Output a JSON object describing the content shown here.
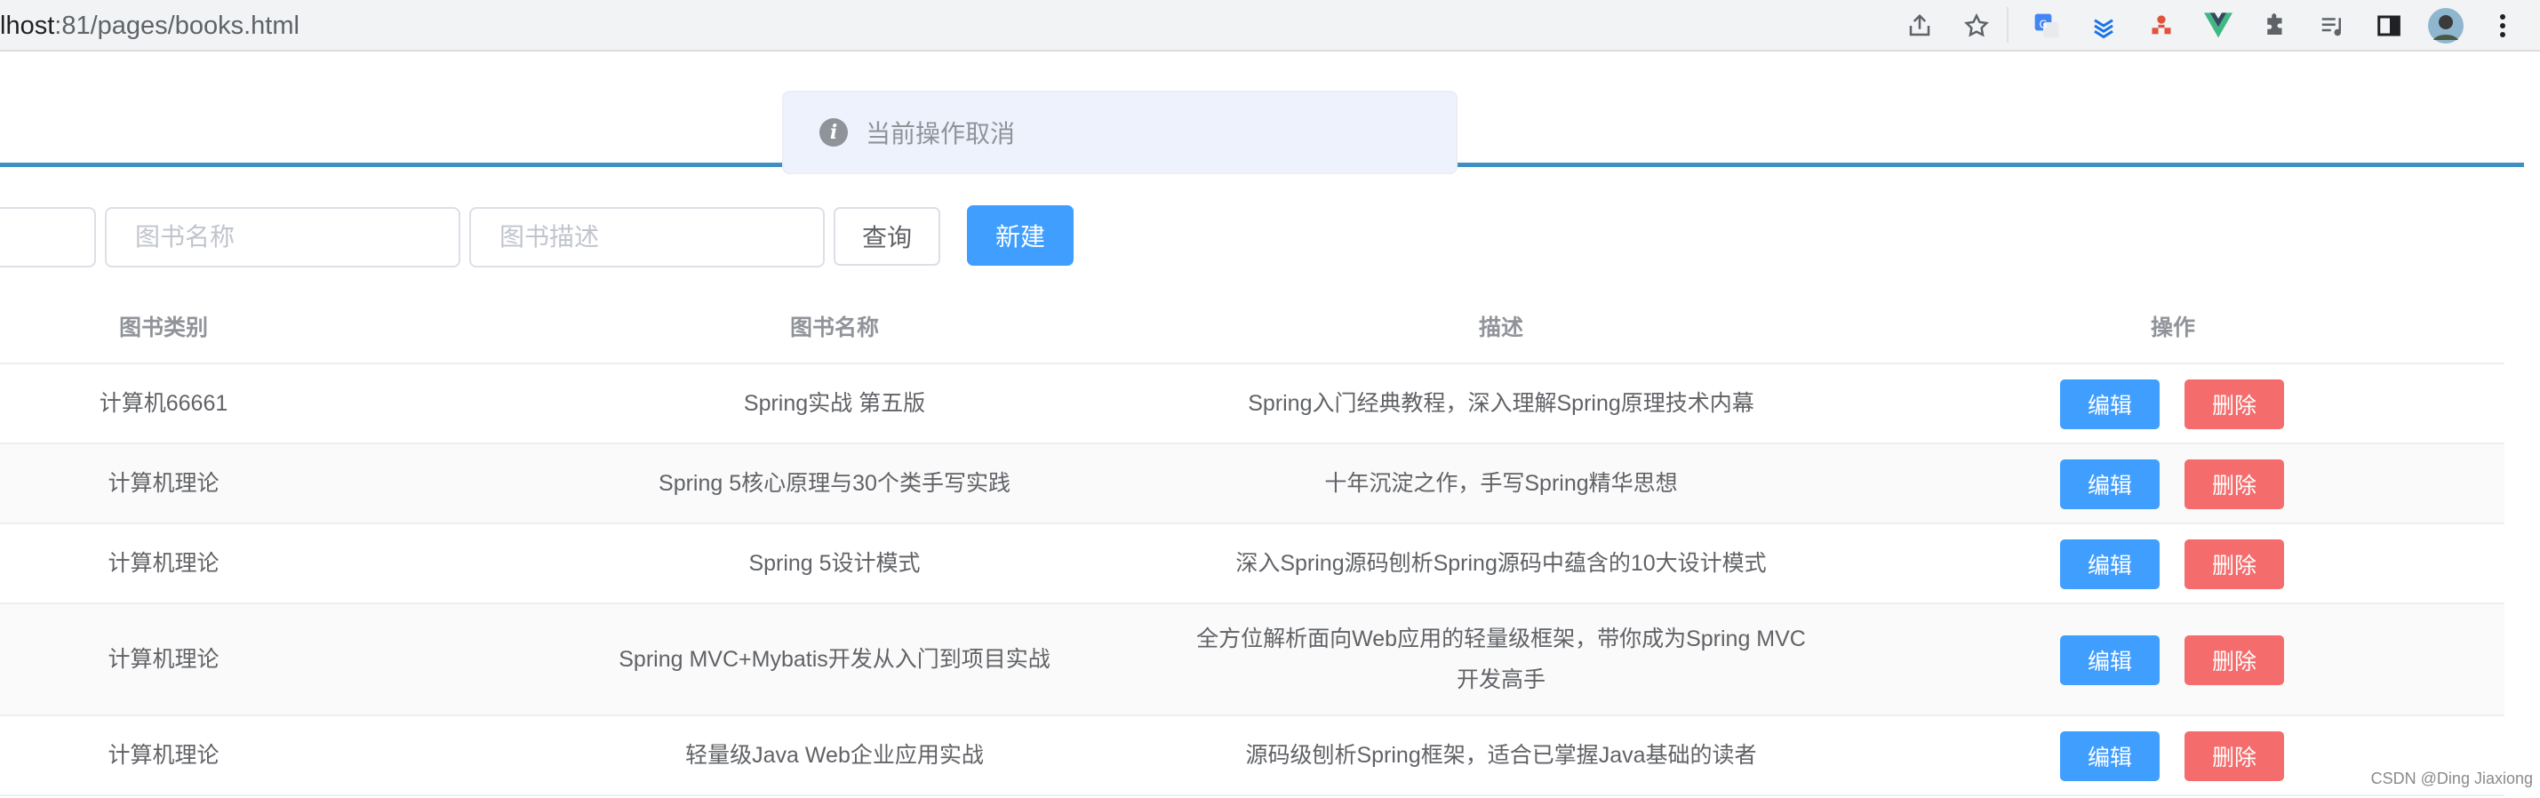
{
  "browser": {
    "url_prefix": "lhost",
    "url_rest": ":81/pages/books.html",
    "icons": [
      "share-icon",
      "star-icon",
      "translate-icon",
      "layers-icon",
      "extension-red-icon",
      "vue-icon",
      "puzzle-icon",
      "playlist-icon",
      "sidebar-icon",
      "profile-avatar",
      "menu-dots-icon"
    ]
  },
  "toast": {
    "text": "当前操作取消"
  },
  "search": {
    "book_name_placeholder": "图书名称",
    "book_desc_placeholder": "图书描述",
    "query_label": "查询",
    "new_label": "新建"
  },
  "table": {
    "headers": {
      "category": "图书类别",
      "name": "图书名称",
      "description": "描述",
      "operations": "操作"
    },
    "rows": [
      {
        "category": "计算机66661",
        "name": "Spring实战 第五版",
        "description": "Spring入门经典教程，深入理解Spring原理技术内幕",
        "edit": "编辑",
        "delete": "删除"
      },
      {
        "category": "计算机理论",
        "name": "Spring 5核心原理与30个类手写实践",
        "description": "十年沉淀之作，手写Spring精华思想",
        "edit": "编辑",
        "delete": "删除"
      },
      {
        "category": "计算机理论",
        "name": "Spring 5设计模式",
        "description": "深入Spring源码刨析Spring源码中蕴含的10大设计模式",
        "edit": "编辑",
        "delete": "删除"
      },
      {
        "category": "计算机理论",
        "name": "Spring MVC+Mybatis开发从入门到项目实战",
        "description": "全方位解析面向Web应用的轻量级框架，带你成为Spring MVC开发高手",
        "edit": "编辑",
        "delete": "删除"
      },
      {
        "category": "计算机理论",
        "name": "轻量级Java Web企业应用实战",
        "description": "源码级刨析Spring框架，适合已掌握Java基础的读者",
        "edit": "编辑",
        "delete": "删除"
      }
    ]
  },
  "watermark": "CSDN @Ding Jiaxiong",
  "colors": {
    "primary": "#409eff",
    "danger": "#f56c6c",
    "info": "#909399"
  }
}
